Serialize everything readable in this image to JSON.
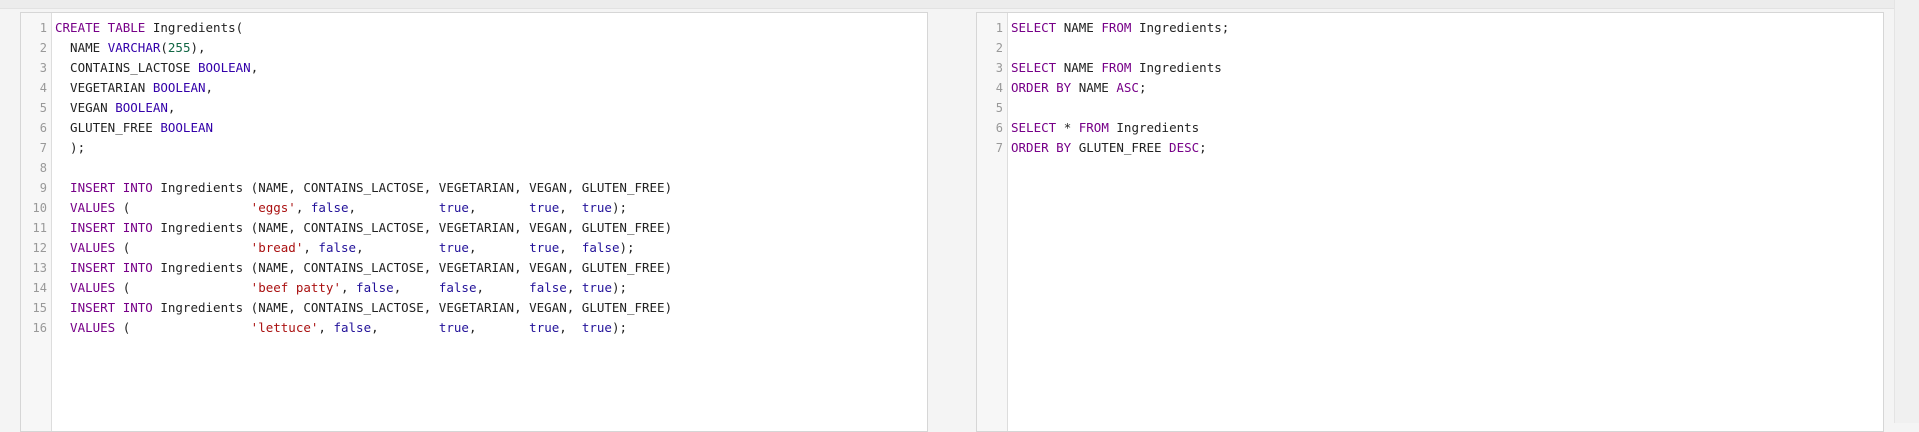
{
  "left_editor": {
    "line_numbers": [
      "1",
      "2",
      "3",
      "4",
      "5",
      "6",
      "7",
      "8",
      "9",
      "10",
      "11",
      "12",
      "13",
      "14",
      "15",
      "16"
    ],
    "lines": [
      [
        {
          "t": "CREATE TABLE ",
          "c": "kw"
        },
        {
          "t": "Ingredients(",
          "c": ""
        }
      ],
      [
        {
          "t": "  NAME ",
          "c": ""
        },
        {
          "t": "VARCHAR",
          "c": "ty"
        },
        {
          "t": "(",
          "c": ""
        },
        {
          "t": "255",
          "c": "num"
        },
        {
          "t": "),",
          "c": ""
        }
      ],
      [
        {
          "t": "  CONTAINS_LACTOSE ",
          "c": ""
        },
        {
          "t": "BOOLEAN",
          "c": "ty"
        },
        {
          "t": ",",
          "c": ""
        }
      ],
      [
        {
          "t": "  VEGETARIAN ",
          "c": ""
        },
        {
          "t": "BOOLEAN",
          "c": "ty"
        },
        {
          "t": ",",
          "c": ""
        }
      ],
      [
        {
          "t": "  VEGAN ",
          "c": ""
        },
        {
          "t": "BOOLEAN",
          "c": "ty"
        },
        {
          "t": ",",
          "c": ""
        }
      ],
      [
        {
          "t": "  GLUTEN_FREE ",
          "c": ""
        },
        {
          "t": "BOOLEAN",
          "c": "ty"
        }
      ],
      [
        {
          "t": "  );",
          "c": ""
        }
      ],
      [
        {
          "t": "",
          "c": ""
        }
      ],
      [
        {
          "t": "  INSERT INTO ",
          "c": "kw"
        },
        {
          "t": "Ingredients (NAME, CONTAINS_LACTOSE, VEGETARIAN, VEGAN, GLUTEN_FREE)",
          "c": ""
        }
      ],
      [
        {
          "t": "  VALUES ",
          "c": "kw"
        },
        {
          "t": "(                ",
          "c": ""
        },
        {
          "t": "'eggs'",
          "c": "str"
        },
        {
          "t": ", ",
          "c": ""
        },
        {
          "t": "false",
          "c": "at"
        },
        {
          "t": ",           ",
          "c": ""
        },
        {
          "t": "true",
          "c": "at"
        },
        {
          "t": ",       ",
          "c": ""
        },
        {
          "t": "true",
          "c": "at"
        },
        {
          "t": ",  ",
          "c": ""
        },
        {
          "t": "true",
          "c": "at"
        },
        {
          "t": ");",
          "c": ""
        }
      ],
      [
        {
          "t": "  INSERT INTO ",
          "c": "kw"
        },
        {
          "t": "Ingredients (NAME, CONTAINS_LACTOSE, VEGETARIAN, VEGAN, GLUTEN_FREE)",
          "c": ""
        }
      ],
      [
        {
          "t": "  VALUES ",
          "c": "kw"
        },
        {
          "t": "(                ",
          "c": ""
        },
        {
          "t": "'bread'",
          "c": "str"
        },
        {
          "t": ", ",
          "c": ""
        },
        {
          "t": "false",
          "c": "at"
        },
        {
          "t": ",          ",
          "c": ""
        },
        {
          "t": "true",
          "c": "at"
        },
        {
          "t": ",       ",
          "c": ""
        },
        {
          "t": "true",
          "c": "at"
        },
        {
          "t": ",  ",
          "c": ""
        },
        {
          "t": "false",
          "c": "at"
        },
        {
          "t": ");",
          "c": ""
        }
      ],
      [
        {
          "t": "  INSERT INTO ",
          "c": "kw"
        },
        {
          "t": "Ingredients (NAME, CONTAINS_LACTOSE, VEGETARIAN, VEGAN, GLUTEN_FREE)",
          "c": ""
        }
      ],
      [
        {
          "t": "  VALUES ",
          "c": "kw"
        },
        {
          "t": "(                ",
          "c": ""
        },
        {
          "t": "'beef patty'",
          "c": "str"
        },
        {
          "t": ", ",
          "c": ""
        },
        {
          "t": "false",
          "c": "at"
        },
        {
          "t": ",     ",
          "c": ""
        },
        {
          "t": "false",
          "c": "at"
        },
        {
          "t": ",      ",
          "c": ""
        },
        {
          "t": "false",
          "c": "at"
        },
        {
          "t": ", ",
          "c": ""
        },
        {
          "t": "true",
          "c": "at"
        },
        {
          "t": ");",
          "c": ""
        }
      ],
      [
        {
          "t": "  INSERT INTO ",
          "c": "kw"
        },
        {
          "t": "Ingredients (NAME, CONTAINS_LACTOSE, VEGETARIAN, VEGAN, GLUTEN_FREE)",
          "c": ""
        }
      ],
      [
        {
          "t": "  VALUES ",
          "c": "kw"
        },
        {
          "t": "(                ",
          "c": ""
        },
        {
          "t": "'lettuce'",
          "c": "str"
        },
        {
          "t": ", ",
          "c": ""
        },
        {
          "t": "false",
          "c": "at"
        },
        {
          "t": ",        ",
          "c": ""
        },
        {
          "t": "true",
          "c": "at"
        },
        {
          "t": ",       ",
          "c": ""
        },
        {
          "t": "true",
          "c": "at"
        },
        {
          "t": ",  ",
          "c": ""
        },
        {
          "t": "true",
          "c": "at"
        },
        {
          "t": ");",
          "c": ""
        }
      ]
    ]
  },
  "right_editor": {
    "line_numbers": [
      "1",
      "2",
      "3",
      "4",
      "5",
      "6",
      "7"
    ],
    "lines": [
      [
        {
          "t": "SELECT ",
          "c": "kw"
        },
        {
          "t": "NAME ",
          "c": ""
        },
        {
          "t": "FROM ",
          "c": "kw"
        },
        {
          "t": "Ingredients;",
          "c": ""
        }
      ],
      [
        {
          "t": "",
          "c": ""
        }
      ],
      [
        {
          "t": "SELECT ",
          "c": "kw"
        },
        {
          "t": "NAME ",
          "c": ""
        },
        {
          "t": "FROM ",
          "c": "kw"
        },
        {
          "t": "Ingredients",
          "c": ""
        }
      ],
      [
        {
          "t": "ORDER BY ",
          "c": "kw"
        },
        {
          "t": "NAME ",
          "c": ""
        },
        {
          "t": "ASC",
          "c": "kw"
        },
        {
          "t": ";",
          "c": ""
        }
      ],
      [
        {
          "t": "",
          "c": ""
        }
      ],
      [
        {
          "t": "SELECT ",
          "c": "kw"
        },
        {
          "t": "* ",
          "c": ""
        },
        {
          "t": "FROM ",
          "c": "kw"
        },
        {
          "t": "Ingredients",
          "c": ""
        }
      ],
      [
        {
          "t": "ORDER BY ",
          "c": "kw"
        },
        {
          "t": "GLUTEN_FREE ",
          "c": ""
        },
        {
          "t": "DESC",
          "c": "kw"
        },
        {
          "t": ";",
          "c": ""
        }
      ]
    ]
  },
  "colors": {
    "keyword": "#770088",
    "type": "#3300aa",
    "number": "#116644",
    "string": "#aa1111",
    "atom": "#221199"
  }
}
